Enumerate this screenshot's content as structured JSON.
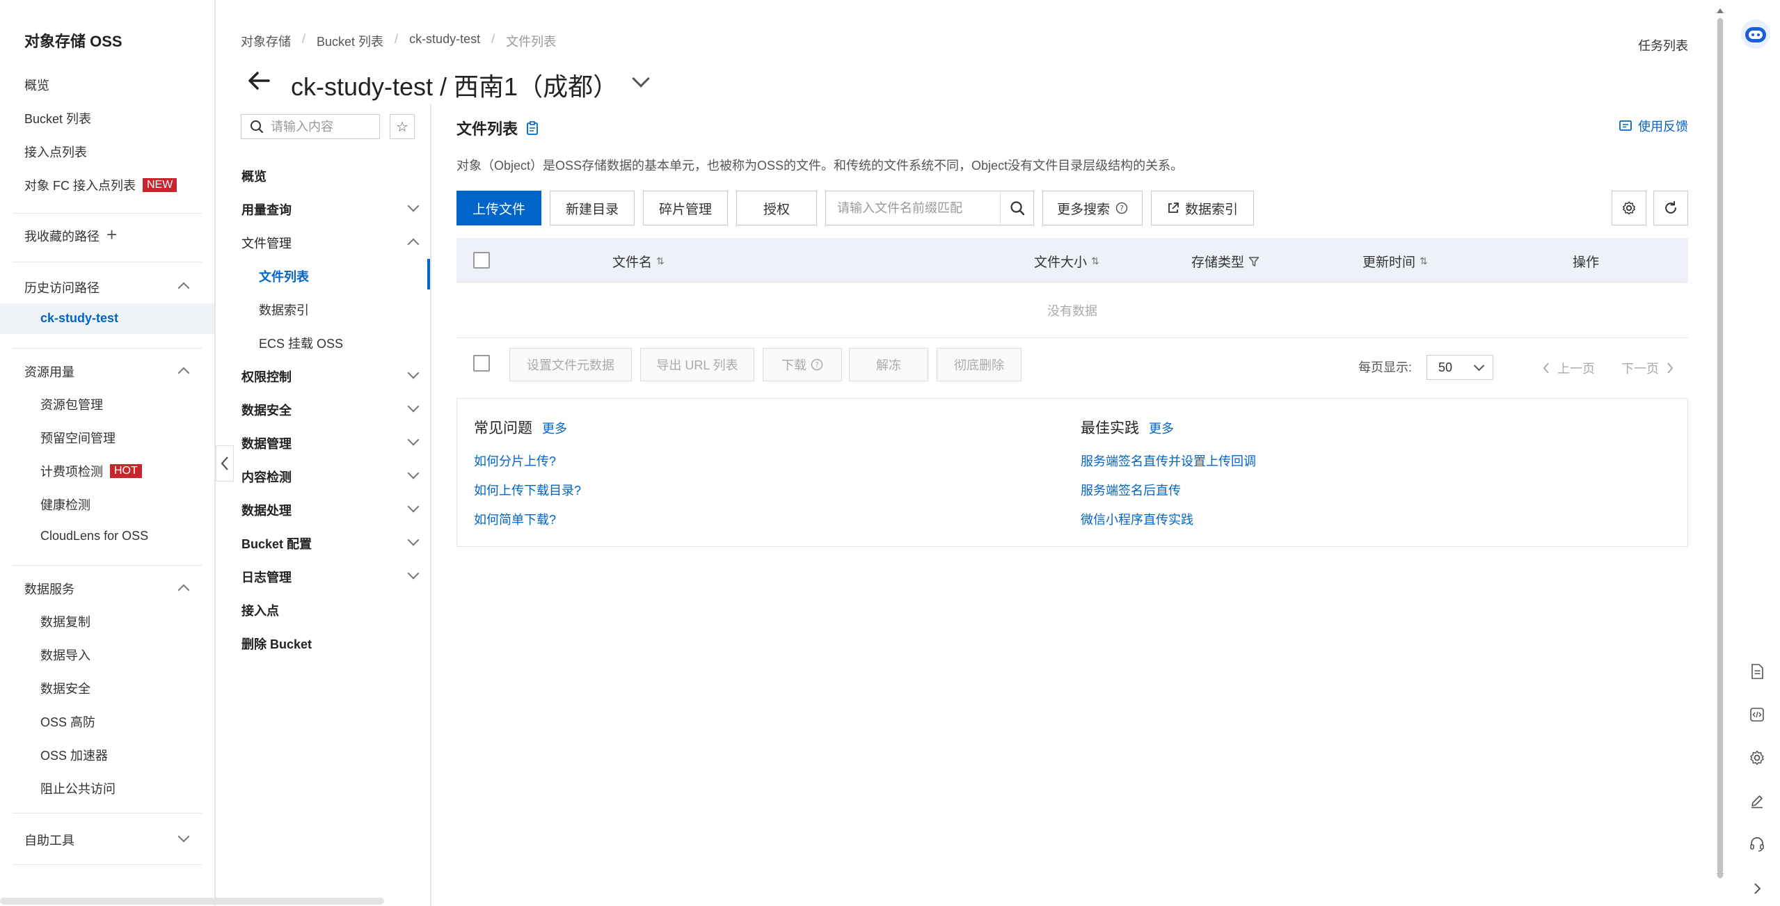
{
  "leftnav": {
    "title": "对象存储 OSS",
    "items": [
      {
        "label": "概览"
      },
      {
        "label": "Bucket 列表"
      },
      {
        "label": "接入点列表"
      },
      {
        "label": "对象 FC 接入点列表",
        "badge": "NEW"
      }
    ],
    "favorites": "我收藏的路径",
    "history": {
      "label": "历史访问路径",
      "active_item": "ck-study-test"
    },
    "resources": {
      "label": "资源用量",
      "items": [
        {
          "label": "资源包管理"
        },
        {
          "label": "预留空间管理"
        },
        {
          "label": "计费项检测",
          "badge": "HOT"
        },
        {
          "label": "健康检测"
        },
        {
          "label": "CloudLens for OSS"
        }
      ]
    },
    "data_services": {
      "label": "数据服务",
      "items": [
        {
          "label": "数据复制"
        },
        {
          "label": "数据导入"
        },
        {
          "label": "数据安全"
        },
        {
          "label": "OSS 高防"
        },
        {
          "label": "OSS 加速器"
        },
        {
          "label": "阻止公共访问"
        }
      ]
    },
    "self_tools": "自助工具"
  },
  "header": {
    "breadcrumb": [
      "对象存储",
      "Bucket 列表",
      "ck-study-test",
      "文件列表"
    ],
    "task_list": "任务列表",
    "title": "ck-study-test / 西南1（成都）"
  },
  "midnav": {
    "search_placeholder": "请输入内容",
    "items": [
      {
        "label": "概览"
      },
      {
        "label": "用量查询"
      },
      {
        "label": "文件管理"
      },
      {
        "label": "文件列表"
      },
      {
        "label": "数据索引"
      },
      {
        "label": "ECS 挂载 OSS"
      },
      {
        "label": "权限控制"
      },
      {
        "label": "数据安全"
      },
      {
        "label": "数据管理"
      },
      {
        "label": "内容检测"
      },
      {
        "label": "数据处理"
      },
      {
        "label": "Bucket 配置"
      },
      {
        "label": "日志管理"
      },
      {
        "label": "接入点"
      },
      {
        "label": "删除 Bucket"
      }
    ]
  },
  "main": {
    "title": "文件列表",
    "feedback": "使用反馈",
    "description": "对象（Object）是OSS存储数据的基本单元，也被称为OSS的文件。和传统的文件系统不同，Object没有文件目录层级结构的关系。",
    "toolbar": {
      "upload": "上传文件",
      "new_dir": "新建目录",
      "fragments": "碎片管理",
      "authorize": "授权",
      "search_placeholder": "请输入文件名前缀匹配",
      "more_search": "更多搜索",
      "data_index": "数据索引"
    },
    "table": {
      "columns": [
        "文件名",
        "文件大小",
        "存储类型",
        "更新时间",
        "操作"
      ],
      "empty": "没有数据"
    },
    "bulk": {
      "set_meta": "设置文件元数据",
      "export_url": "导出 URL 列表",
      "download": "下载",
      "unfreeze": "解冻",
      "delete": "彻底删除"
    },
    "pagination": {
      "per_page_label": "每页显示:",
      "per_page": "50",
      "prev": "上一页",
      "next": "下一页"
    },
    "faq": {
      "title": "常见问题",
      "more": "更多",
      "links": [
        "如何分片上传?",
        "如何上传下载目录?",
        "如何简单下载?"
      ]
    },
    "best_practice": {
      "title": "最佳实践",
      "more": "更多",
      "links": [
        "服务端签名直传并设置上传回调",
        "服务端签名后直传",
        "微信小程序直传实践"
      ]
    }
  },
  "colors": {
    "accent": "#0064c8",
    "brand": "#ff6a00",
    "badge": "#c9252c"
  }
}
